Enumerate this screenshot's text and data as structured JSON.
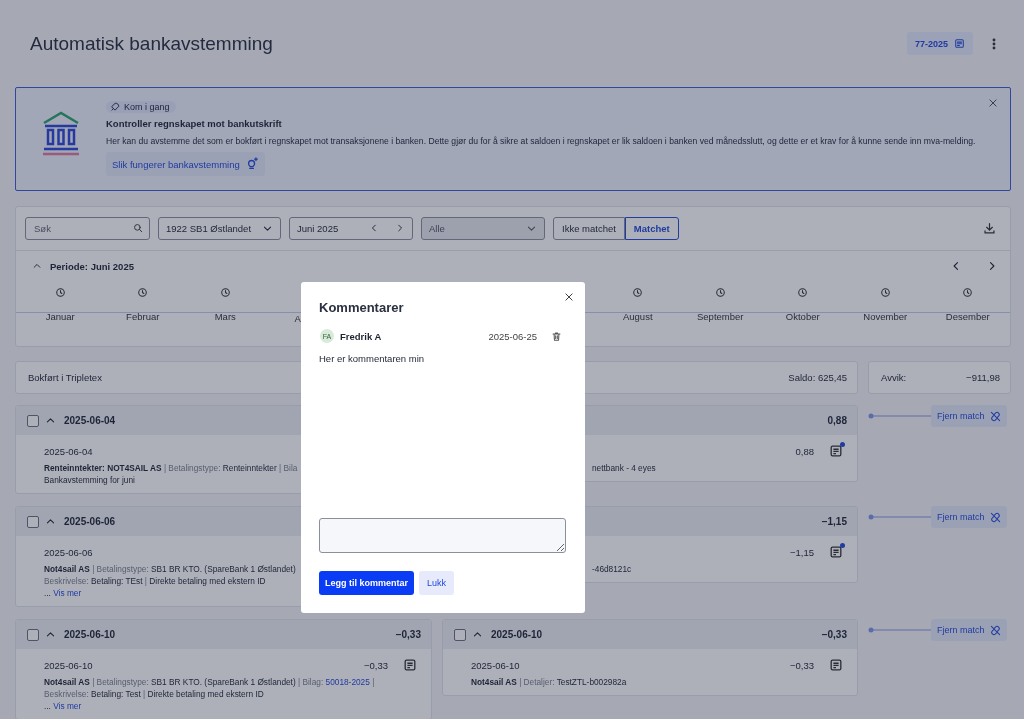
{
  "page": {
    "title": "Automatisk bankavstemming",
    "voucher_button": "77-2025"
  },
  "banner": {
    "badge": "Kom i gang",
    "title": "Kontroller regnskapet mot bankutskrift",
    "text": "Her kan du avstemme det som er bokført i regnskapet mot transaksjonene i banken. Dette gjør du for å sikre at saldoen i regnskapet er lik saldoen i banken ved månedsslutt, og dette er et krav for å kunne sende inn mva-melding.",
    "link": "Slik fungerer bankavstemming"
  },
  "filters": {
    "search": {
      "placeholder": "Søk"
    },
    "account": "1922 SB1 Østlandet",
    "period": "Juni 2025",
    "status_select": {
      "placeholder": "Alle",
      "disabled": true
    },
    "toggle": [
      {
        "label": "Ikke matchet",
        "selected": false
      },
      {
        "label": "Matchet",
        "selected": true
      }
    ]
  },
  "timeline": {
    "title": "Periode: Juni 2025",
    "expanded": true,
    "months_before": [
      {
        "label": "Januar",
        "partial": false
      },
      {
        "label": "Februar",
        "partial": false
      },
      {
        "label": "Mars",
        "partial": false
      },
      {
        "label": "A",
        "partial": true
      }
    ],
    "months_after": [
      {
        "label": "August"
      },
      {
        "label": "September"
      },
      {
        "label": "Oktober"
      },
      {
        "label": "November"
      },
      {
        "label": "Desember"
      }
    ]
  },
  "summary": {
    "label": "Bokført i Tripletex",
    "balance": "Saldo: 625,45",
    "deviation_label": "Avvik:",
    "deviation": "−911,98"
  },
  "groups": [
    {
      "left": {
        "checked": false,
        "expanded": true,
        "date": "2025-06-04",
        "entry_date": "2025-06-04",
        "lines": [
          [
            {
              "kind": "name",
              "text": "Renteinntekter: NOT4SAIL AS"
            },
            {
              "kind": "sep",
              "text": "|"
            },
            {
              "kind": "label",
              "text": "Betalingstype:"
            },
            {
              "kind": "text",
              "text": "Renteinntekter"
            },
            {
              "kind": "sep",
              "text": "|"
            },
            {
              "kind": "label",
              "text": "Bila"
            }
          ],
          [
            {
              "kind": "text",
              "text": "Bankavstemming for juni"
            }
          ]
        ]
      },
      "right": {
        "header_amount": "0,88",
        "amount": "0,88",
        "comment_icon": {
          "dot": true
        },
        "line_tails": [
          [
            {
              "kind": "text",
              "text": "nettbank - 4 eyes"
            }
          ]
        ]
      },
      "unmatch_button": "Fjern match"
    },
    {
      "left": {
        "checked": false,
        "expanded": true,
        "date": "2025-06-06",
        "entry_date": "2025-06-06",
        "lines": [
          [
            {
              "kind": "name",
              "text": "Not4sail AS"
            },
            {
              "kind": "sep",
              "text": "|"
            },
            {
              "kind": "label",
              "text": "Betalingstype:"
            },
            {
              "kind": "text",
              "text": "SB1 BR KTO. (SpareBank 1 Østlandet)"
            }
          ],
          [
            {
              "kind": "label",
              "text": "Beskrivelse:"
            },
            {
              "kind": "text",
              "text": "Betaling: TEst"
            },
            {
              "kind": "sep",
              "text": "|"
            },
            {
              "kind": "text",
              "text": "Direkte betaling med ekstern ID"
            }
          ],
          [
            {
              "kind": "text",
              "text": "..."
            },
            {
              "kind": "link",
              "text": "Vis mer"
            }
          ]
        ]
      },
      "right": {
        "header_amount": "−1,15",
        "amount": "−1,15",
        "comment_icon": {
          "dot": true
        },
        "line_tails": [
          [
            {
              "kind": "text",
              "text": "-46d8121c"
            }
          ]
        ]
      },
      "unmatch_button": "Fjern match"
    },
    {
      "left": {
        "checked": false,
        "expanded": true,
        "date": "2025-06-10",
        "header_amount": "−0,33",
        "entry_date": "2025-06-10",
        "amount": "−0,33",
        "comment_icon": {
          "dot": false
        },
        "lines": [
          [
            {
              "kind": "name",
              "text": "Not4sail AS"
            },
            {
              "kind": "sep",
              "text": "|"
            },
            {
              "kind": "label",
              "text": "Betalingstype:"
            },
            {
              "kind": "text",
              "text": "SB1 BR KTO. (SpareBank 1 Østlandet)"
            },
            {
              "kind": "sep",
              "text": "|"
            },
            {
              "kind": "label",
              "text": "Bilag:"
            },
            {
              "kind": "link",
              "text": "50018-2025"
            },
            {
              "kind": "sep",
              "text": "|"
            }
          ],
          [
            {
              "kind": "label",
              "text": "Beskrivelse:"
            },
            {
              "kind": "text",
              "text": "Betaling: Test"
            },
            {
              "kind": "sep",
              "text": "|"
            },
            {
              "kind": "text",
              "text": "Direkte betaling med ekstern ID"
            }
          ],
          [
            {
              "kind": "text",
              "text": "..."
            },
            {
              "kind": "link",
              "text": "Vis mer"
            }
          ]
        ]
      },
      "right": {
        "checked": false,
        "expanded": true,
        "date": "2025-06-10",
        "header_amount": "−0,33",
        "entry_date": "2025-06-10",
        "amount": "−0,33",
        "comment_icon": {
          "dot": false
        },
        "lines": [
          [
            {
              "kind": "name",
              "text": "Not4sail AS"
            },
            {
              "kind": "sep",
              "text": "|"
            },
            {
              "kind": "label",
              "text": "Detaljer:"
            },
            {
              "kind": "text",
              "text": "TestZTL-b002982a"
            }
          ]
        ]
      },
      "unmatch_button": "Fjern match"
    }
  ],
  "modal": {
    "title": "Kommentarer",
    "comments": [
      {
        "initials": "FA",
        "author": "Fredrik A",
        "date": "2025-06-25",
        "text": "Her er kommentaren min"
      }
    ],
    "primary_button": "Legg til kommentar",
    "secondary_button": "Lukk"
  }
}
